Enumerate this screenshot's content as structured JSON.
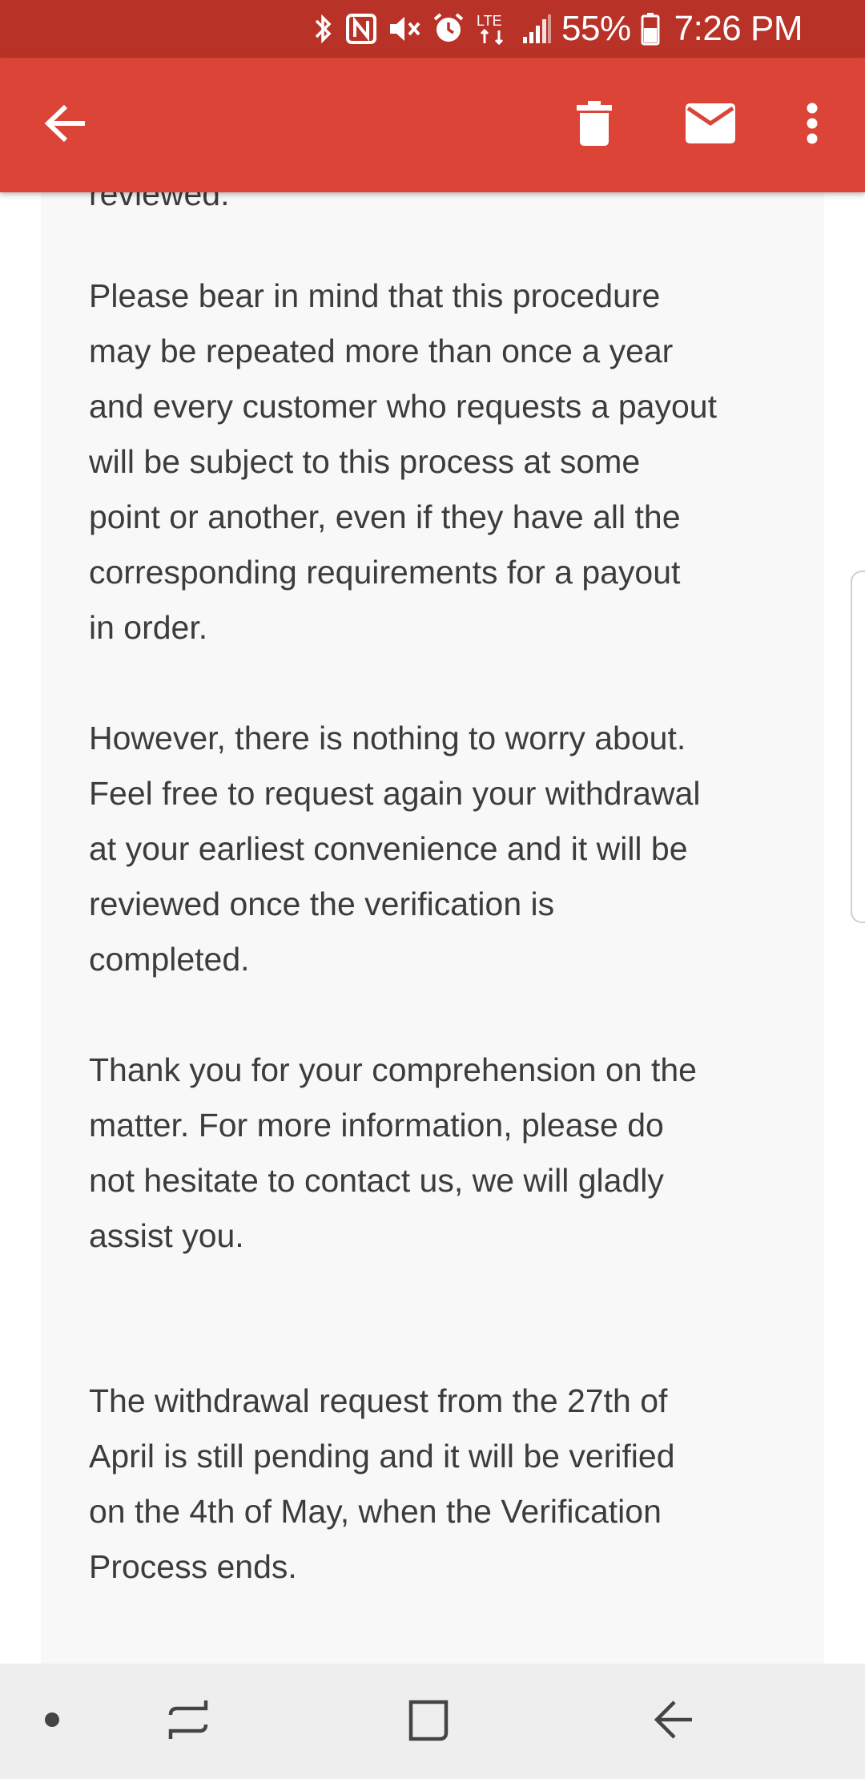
{
  "status_bar": {
    "battery_percent": "55%",
    "time": "7:26 PM",
    "network": "LTE",
    "icons": [
      "bluetooth-icon",
      "nfc-icon",
      "mute-icon",
      "alarm-icon",
      "lte-icon",
      "signal-icon",
      "battery-icon"
    ]
  },
  "app_bar": {
    "icons": [
      "back-arrow-icon",
      "delete-icon",
      "mail-icon",
      "more-vert-icon"
    ],
    "color": "#db4437"
  },
  "message": {
    "partial_top": "reviewed.",
    "paragraphs": [
      "Please bear in mind that this procedure\nmay be repeated more than once a year\nand every customer who requests a payout\nwill be subject to this process at some\npoint or another, even if they have all the\ncorresponding requirements for a payout\nin order.",
      "However, there is nothing to worry about.\nFeel free to request again your withdrawal\nat your earliest convenience and it will be\nreviewed once the verification is\ncompleted.",
      "Thank you for your comprehension on the\nmatter. For more information, please do\nnot hesitate to contact us, we will gladly\nassist you.",
      "The withdrawal request from the 27th of\nApril is still pending and it will be verified\non the 4th of May, when the Verification\nProcess ends."
    ]
  },
  "nav_bar": {
    "icons": [
      "dot-icon",
      "recents-icon",
      "home-icon",
      "back-icon"
    ]
  }
}
